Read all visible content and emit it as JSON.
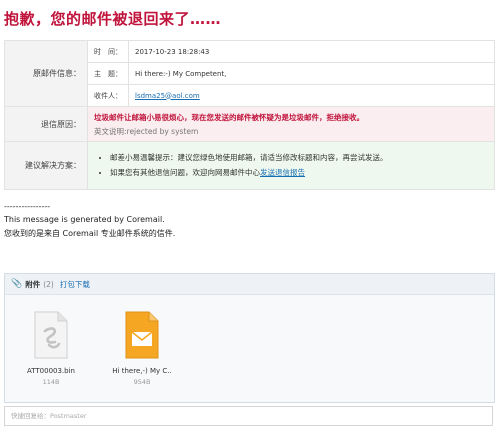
{
  "headline": "抱歉，您的邮件被退回来了……",
  "original_mail": {
    "section_label": "原邮件信息：",
    "time_label": "时　间：",
    "time_value": "2017-10-23 18:28:43",
    "subject_label": "主　题：",
    "subject_value": "Hi there:-) My Competent,",
    "recipient_label": "收件人：",
    "recipient_value": "lsdma25@aol.com"
  },
  "bounce": {
    "section_label": "退信原因：",
    "reason": "垃圾邮件让邮箱小易很烦心，现在您发送的邮件被怀疑为是垃圾邮件，拒绝接收。",
    "english_note": "英文说明:rejected by system"
  },
  "suggestion": {
    "section_label": "建议解决方案：",
    "item1": "邮差小易温馨提示：建议您绿色地使用邮箱，请适当修改标题和内容，再尝试发送。",
    "item2_prefix": "如果您有其他退信问题，欢迎向网易邮件中心",
    "item2_link": "发送退信报告"
  },
  "footer": {
    "divider": "----------------",
    "line1": "This message is generated by Coremail.",
    "line2": "您收到的是来自 Coremail 专业邮件系统的信件."
  },
  "attachments": {
    "title": "附件",
    "count": "(2)",
    "download_label": "打包下载",
    "files": [
      {
        "name": "ATT00003.bin",
        "size": "114B",
        "icon": "generic-file-icon"
      },
      {
        "name": "Hi there,-) My C..",
        "size": "954B",
        "icon": "email-file-icon"
      }
    ]
  },
  "quick_reply": {
    "placeholder": "快捷回复给：Postmaster"
  },
  "colors": {
    "headline": "#c0143c",
    "link": "#1a6fb3",
    "bounce_bg": "#fbeef0",
    "suggest_bg": "#eef8ee",
    "email_icon": "#f5a623"
  }
}
